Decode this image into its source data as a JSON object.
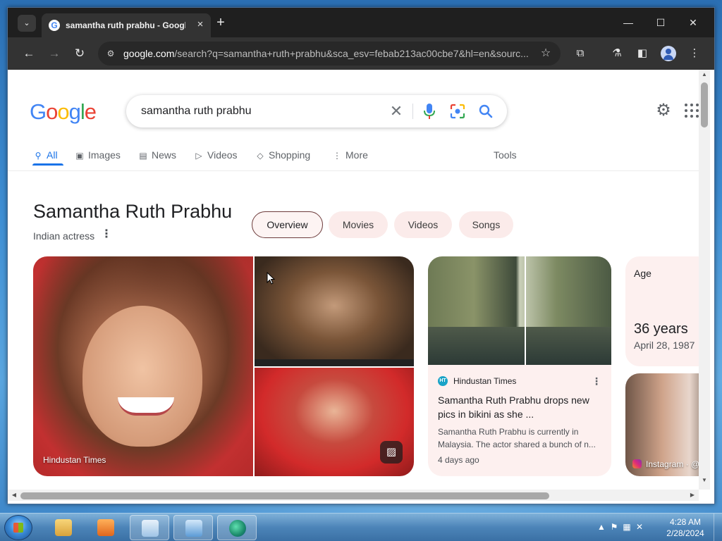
{
  "browser": {
    "tab_title": "samantha ruth prabhu - Google Search",
    "tab_favicon": "G",
    "url_host": "google.com",
    "url_path": "/search?q=samantha+ruth+prabhu&sca_esv=febab213ac00cbe7&hl=en&sourc...",
    "window_controls": {
      "minimize": "—",
      "maximize": "☐",
      "close": "✕"
    }
  },
  "search": {
    "logo": [
      "G",
      "o",
      "o",
      "g",
      "l",
      "e"
    ],
    "query": "samantha ruth prabhu"
  },
  "tabs": [
    {
      "label": "All",
      "icon": "search-icon",
      "active": true
    },
    {
      "label": "Images",
      "icon": "image-icon"
    },
    {
      "label": "News",
      "icon": "news-icon"
    },
    {
      "label": "Videos",
      "icon": "play-icon"
    },
    {
      "label": "Shopping",
      "icon": "tag-icon"
    },
    {
      "label": "More",
      "icon": "kebab-icon"
    }
  ],
  "tools_label": "Tools",
  "knowledge_panel": {
    "title": "Samantha Ruth Prabhu",
    "subtitle": "Indian actress",
    "chips": [
      "Overview",
      "Movies",
      "Videos",
      "Songs"
    ],
    "main_image_caption": "Hindustan Times"
  },
  "news_card": {
    "source": "Hindustan Times",
    "source_logo": "HT",
    "headline": "Samantha Ruth Prabhu drops new pics in bikini as she ...",
    "snippet": "Samantha Ruth Prabhu is currently in Malaysia. The actor shared a bunch of n...",
    "time": "4 days ago"
  },
  "age_card": {
    "label": "Age",
    "value": "36 years",
    "dob": "April 28, 1987"
  },
  "instagram_card": {
    "label": "Instagram · @"
  },
  "taskbar": {
    "time": "4:28 AM",
    "date": "2/28/2024"
  },
  "colors": {
    "google_blue": "#4285f4",
    "google_red": "#ea4335",
    "google_yellow": "#fbbc05",
    "google_green": "#34a853",
    "active_tab": "#1a73e8",
    "chip_bg": "#fbebea"
  }
}
